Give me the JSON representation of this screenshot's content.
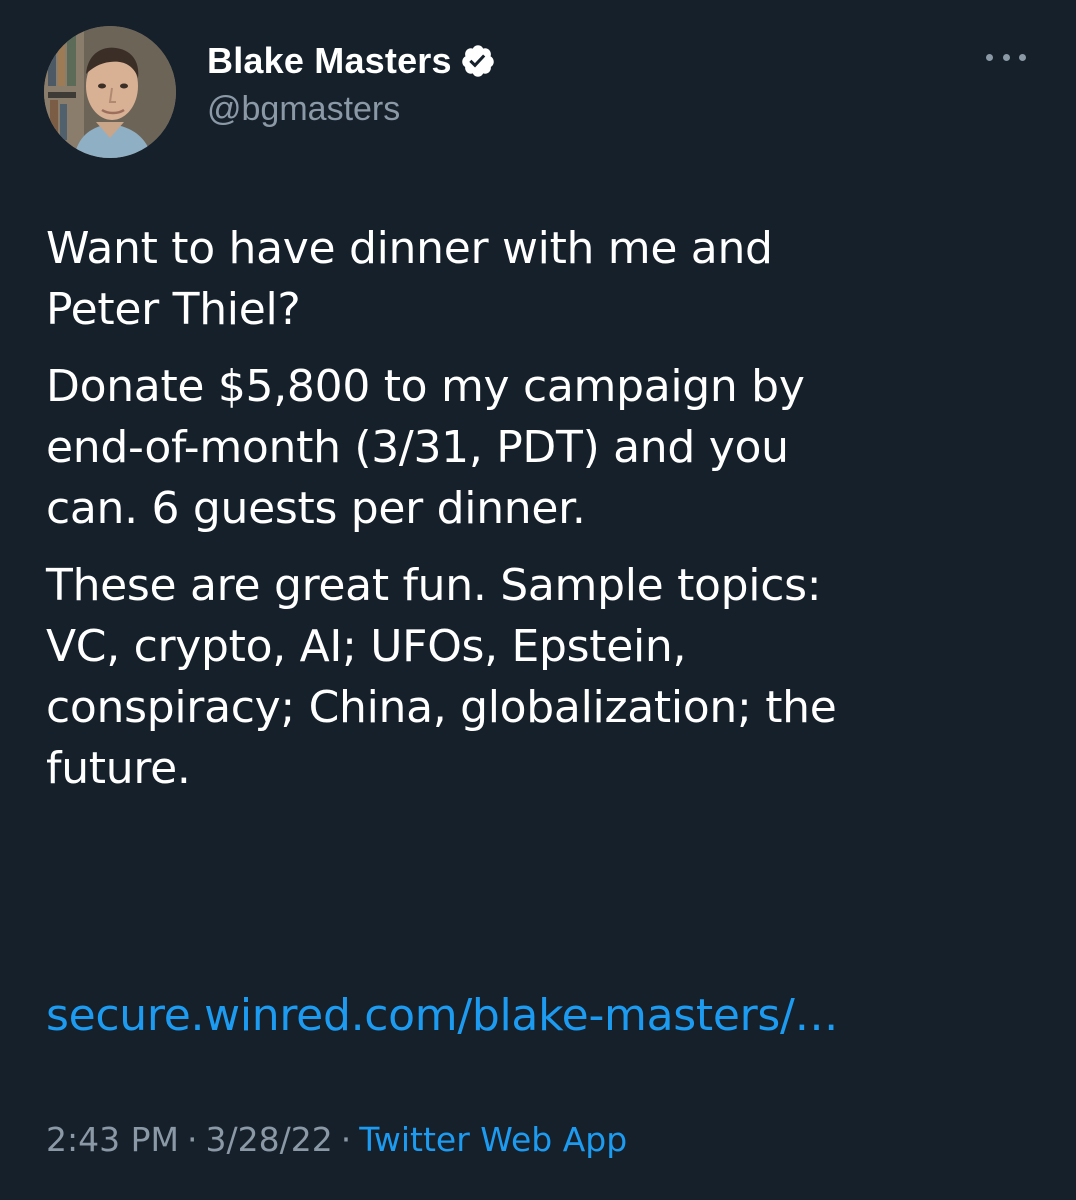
{
  "colors": {
    "background": "#15202b",
    "primary_text": "#ffffff",
    "secondary_text": "#8b98a5",
    "link": "#1d9bf0",
    "verified_badge": "#ffffff"
  },
  "author": {
    "display_name": "Blake Masters",
    "handle": "@bgmasters",
    "verified": true,
    "avatar_icon": "profile-photo",
    "verified_icon": "verified-badge-icon"
  },
  "menu": {
    "icon": "more-options-icon"
  },
  "tweet": {
    "paragraphs": [
      "Want to have dinner with me and\nPeter Thiel?",
      "Donate $5,800 to my campaign by\nend-of-month (3/31, PDT) and you\ncan. 6 guests per dinner.",
      "These are great fun. Sample topics:\nVC, crypto, AI; UFOs, Epstein,\nconspiracy; China, globalization; the\nfuture."
    ],
    "link_text": "secure.winred.com/blake-masters/…"
  },
  "meta": {
    "time": "2:43 PM",
    "separator": "·",
    "date": "3/28/22",
    "source": "Twitter Web App"
  }
}
